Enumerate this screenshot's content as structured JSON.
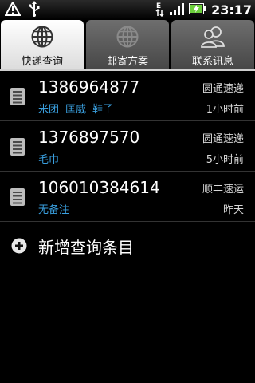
{
  "status_bar": {
    "time": "23:17",
    "icons": [
      "warning-icon",
      "usb-icon",
      "data-transfer-icon",
      "signal-icon",
      "battery-charging-icon"
    ]
  },
  "tabs": [
    {
      "label": "快递查询",
      "icon": "globe-icon",
      "active": true
    },
    {
      "label": "邮寄方案",
      "icon": "globe-icon",
      "active": false
    },
    {
      "label": "联系讯息",
      "icon": "contacts-icon",
      "active": false
    }
  ],
  "records": [
    {
      "number": "1386964877",
      "tags": [
        "米团",
        "匡威",
        "鞋子"
      ],
      "company": "圆通速递",
      "time": "1小时前"
    },
    {
      "number": "1376897570",
      "tags": [
        "毛巾"
      ],
      "company": "圆通速递",
      "time": "5小时前"
    },
    {
      "number": "106010384614",
      "tags": [
        "无备注"
      ],
      "company": "顺丰速运",
      "time": "昨天"
    }
  ],
  "add_entry": {
    "label": "新增查询条目",
    "icon": "add-circle-icon"
  },
  "colors": {
    "tag": "#3aa0e0",
    "background": "#000000"
  }
}
